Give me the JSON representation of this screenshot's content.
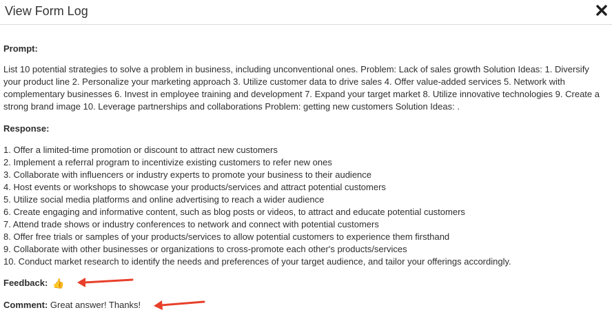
{
  "modal": {
    "title": "View Form Log",
    "close_icon": "close-x-icon"
  },
  "prompt": {
    "heading": "Prompt:",
    "text": "List 10 potential strategies to solve a problem in business, including unconventional ones. Problem: Lack of sales growth Solution Ideas: 1. Diversify your product line 2. Personalize your marketing approach 3. Utilize customer data to drive sales 4. Offer value-added services 5. Network with complementary businesses 6. Invest in employee training and development 7. Expand your target market 8. Utilize innovative technologies 9. Create a strong brand image 10. Leverage partnerships and collaborations Problem: getting new customers Solution Ideas: ."
  },
  "response": {
    "heading": "Response:",
    "items": [
      "1. Offer a limited-time promotion or discount to attract new customers",
      "2. Implement a referral program to incentivize existing customers to refer new ones",
      "3. Collaborate with influencers or industry experts to promote your business to their audience",
      "4. Host events or workshops to showcase your products/services and attract potential customers",
      "5. Utilize social media platforms and online advertising to reach a wider audience",
      "6. Create engaging and informative content, such as blog posts or videos, to attract and educate potential customers",
      "7. Attend trade shows or industry conferences to network and connect with potential customers",
      "8. Offer free trials or samples of your products/services to allow potential customers to experience them firsthand",
      "9. Collaborate with other businesses or organizations to cross-promote each other's products/services",
      "10. Conduct market research to identify the needs and preferences of your target audience, and tailor your offerings accordingly."
    ]
  },
  "feedback": {
    "label": "Feedback:",
    "value": "👍",
    "icon": "thumbs-up-icon"
  },
  "comment": {
    "label": "Comment:",
    "value": "Great answer! Thanks!"
  },
  "colors": {
    "annotation_arrow": "#e8402a",
    "divider": "#dcdcdc",
    "text": "#2e2e2e"
  }
}
